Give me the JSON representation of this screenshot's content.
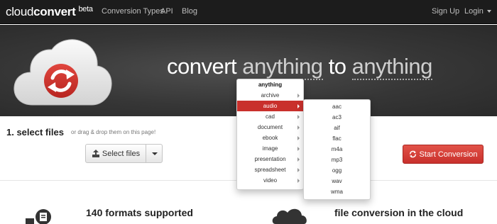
{
  "navbar": {
    "brand_light": "cloud",
    "brand_bold": "convert",
    "brand_tag": "beta",
    "links": [
      "Conversion Types",
      "API",
      "Blog"
    ],
    "signup": "Sign Up",
    "login": "Login"
  },
  "hero": {
    "prefix": "convert",
    "from_word": "anything",
    "middle": "to",
    "to_word": "anything"
  },
  "select": {
    "title": "1. select files",
    "hint": "or drag & drop them on this page!",
    "button": "Select files",
    "start": "Start Conversion"
  },
  "features": {
    "left_title": "140 formats supported",
    "right_title": "file conversion in the cloud"
  },
  "format_menu": {
    "header": "anything",
    "items": [
      "archive",
      "audio",
      "cad",
      "document",
      "ebook",
      "image",
      "presentation",
      "spreadsheet",
      "video"
    ],
    "active": "audio"
  },
  "audio_menu": {
    "items": [
      "aac",
      "ac3",
      "aif",
      "flac",
      "m4a",
      "mp3",
      "ogg",
      "wav",
      "wma"
    ]
  },
  "colors": {
    "navbar": "#1c1c1c",
    "accent_red": "#c9302c",
    "hero_bg": "#3a3a3a"
  },
  "icons": [
    "refresh-icon",
    "upload-icon",
    "cloud-icon",
    "caret-down-icon",
    "caret-right-icon"
  ]
}
